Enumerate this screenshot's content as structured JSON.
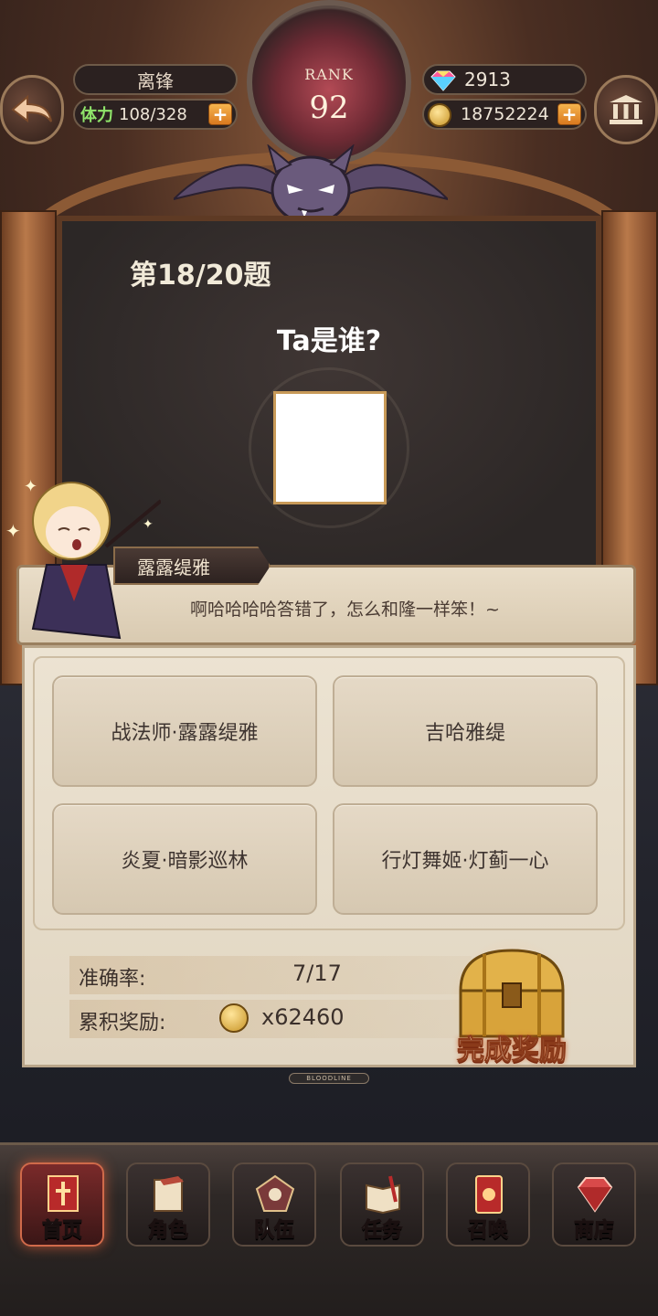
{
  "header": {
    "player_name": "离锋",
    "stamina_label": "体力",
    "stamina_value": "108/328",
    "rank_label": "RANK",
    "rank_value": "92",
    "gems": "2913",
    "gold": "18752224"
  },
  "quiz": {
    "question_number": "第18/20题",
    "question": "Ta是谁?",
    "speaker": "露露缇雅",
    "dialogue": "啊哈哈哈哈答错了，怎么和隆一样笨！~",
    "answers": [
      "战法师·露露缇雅",
      "吉哈雅缇",
      "炎夏·暗影巡林",
      "行灯舞姬·灯蓟一心"
    ]
  },
  "stats": {
    "accuracy_label": "准确率:",
    "accuracy_value": "7/17",
    "reward_label": "累积奖励:",
    "reward_value": "x62460",
    "complete_reward_label": "完成奖励",
    "brand": "BLOODLINE"
  },
  "nav": {
    "items": [
      {
        "label": "首页",
        "icon": "home-banner-icon"
      },
      {
        "label": "角色",
        "icon": "character-icon"
      },
      {
        "label": "队伍",
        "icon": "team-icon"
      },
      {
        "label": "任务",
        "icon": "quest-book-icon"
      },
      {
        "label": "召唤",
        "icon": "summon-card-icon"
      },
      {
        "label": "商店",
        "icon": "shop-gem-icon"
      }
    ],
    "active_index": 0
  },
  "colors": {
    "accent": "#d06a4a",
    "panel": "#e5d9c6",
    "board": "#2c2726",
    "stamina_green": "#8fe46a"
  }
}
